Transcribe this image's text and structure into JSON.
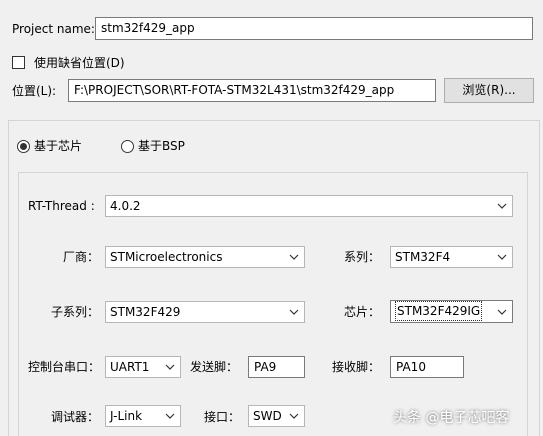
{
  "project_name": {
    "label": "Project name:",
    "value": "stm32f429_app"
  },
  "use_default_location": {
    "label": "使用缺省位置(D)",
    "checked": false
  },
  "location": {
    "label": "位置(L):",
    "value": "F:\\PROJECT\\SOR\\RT-FOTA-STM32L431\\stm32f429_app",
    "browse_label": "浏览(R)..."
  },
  "mode": {
    "chip_label": "基于芯片",
    "bsp_label": "基于BSP",
    "selected": "chip"
  },
  "rt_thread": {
    "label": "RT-Thread :",
    "value": "4.0.2"
  },
  "vendor": {
    "label": "厂商：",
    "value": "STMicroelectronics"
  },
  "series": {
    "label": "系列：",
    "value": "STM32F4"
  },
  "sub_series": {
    "label": "子系列：",
    "value": "STM32F429"
  },
  "chip": {
    "label": "芯片：",
    "value": "STM32F429IG"
  },
  "console": {
    "label": "控制台串口：",
    "value": "UART1",
    "tx_label": "发送脚：",
    "tx_value": "PA9",
    "rx_label": "接收脚：",
    "rx_value": "PA10"
  },
  "debugger": {
    "label": "调试器：",
    "value": "J-Link",
    "interface_label": "接口：",
    "interface_value": "SWD"
  },
  "watermark": {
    "text": "头条 @电子芯吧客"
  },
  "icons": {
    "dropdown": "chevron-down-icon",
    "radio": "radio-icon",
    "checkbox": "checkbox-icon"
  }
}
